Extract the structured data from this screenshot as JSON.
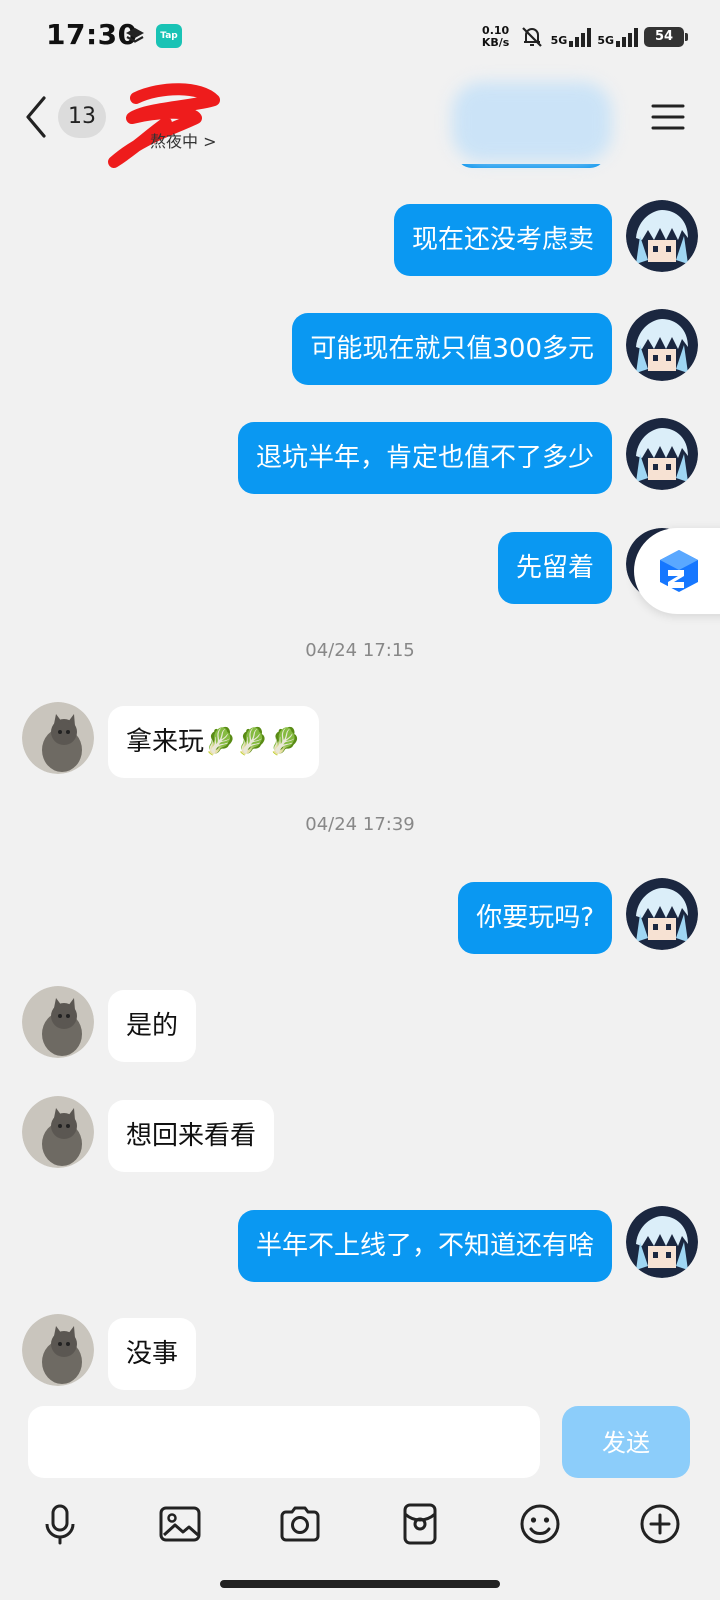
{
  "status_bar": {
    "time": "17:30",
    "tap_badge": "Tap",
    "net_speed_value": "0.10",
    "net_speed_unit": "KB/s",
    "sim1": "5G",
    "sim2": "5G",
    "battery": "54",
    "icons": [
      "layers-icon",
      "tap-app-icon",
      "bell-muted-icon",
      "signal-icon",
      "battery-icon"
    ]
  },
  "header": {
    "unread_count": "13",
    "status_text": "熬夜中 >"
  },
  "messages": [
    {
      "side": "out",
      "text": "现在还没考虑卖"
    },
    {
      "side": "out",
      "text": "可能现在就只值300多元"
    },
    {
      "side": "out",
      "text": "退坑半年，肯定也值不了多少"
    },
    {
      "side": "out",
      "text": "先留着"
    },
    {
      "side": "in",
      "text": "拿来玩🥬🥬🥬"
    },
    {
      "side": "out",
      "text": "你要玩吗?"
    },
    {
      "side": "in",
      "text": "是的"
    },
    {
      "side": "in",
      "text": "想回来看看"
    },
    {
      "side": "out",
      "text": "半年不上线了，不知道还有啥"
    },
    {
      "side": "in",
      "text": "没事"
    }
  ],
  "timestamps": [
    "04/24 17:15",
    "04/24 17:39"
  ],
  "input": {
    "value": "",
    "placeholder": "",
    "send_label": "发送"
  },
  "toolbar": [
    "microphone-icon",
    "image-icon",
    "camera-icon",
    "red-packet-icon",
    "emoji-icon",
    "plus-icon"
  ],
  "colors": {
    "outgoing_bubble": "#0a98f2",
    "incoming_bubble": "#ffffff",
    "send_button": "#8ccdfa",
    "background": "#f1f1f1"
  }
}
